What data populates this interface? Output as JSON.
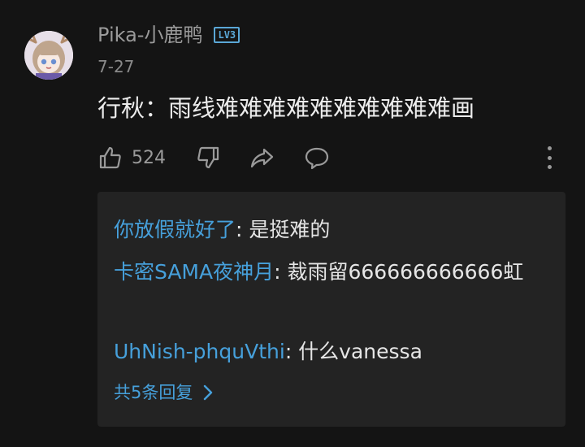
{
  "comment": {
    "username": "Pika-小鹿鸭",
    "level_badge": "LV3",
    "date": "7-27",
    "text": "行秋：雨线难难难难难难难难难难画",
    "like_count": "524"
  },
  "replies": [
    {
      "author": "你放假就好了",
      "text": ": 是挺难的"
    },
    {
      "author": "卡密SAMA夜神月",
      "text": ": 裁雨留666666666666虹"
    },
    {
      "author": "UhNish-phquVthi",
      "text": ": 什么vanessa"
    }
  ],
  "more_replies_label": "共5条回复",
  "colors": {
    "background": "#141414",
    "reply_panel": "#232323",
    "link_blue": "#46a0db",
    "badge_blue": "#5aa7d6",
    "muted": "#9a9a9a"
  },
  "icons": [
    "avatar",
    "thumbs-up-icon",
    "thumbs-down-icon",
    "share-icon",
    "reply-bubble-icon",
    "more-vertical-icon",
    "chevron-right-icon"
  ]
}
